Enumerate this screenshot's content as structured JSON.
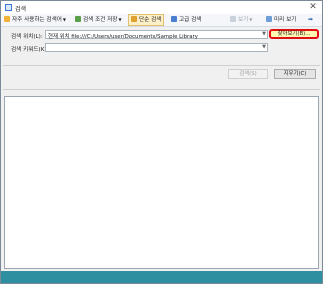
{
  "window": {
    "title": "검색"
  },
  "toolbar": {
    "frequent_searches": "자주 사용하는 검색어",
    "save_search": "검색 조건 저장",
    "simple_search": "단순 검색",
    "advanced_search": "고급 검색",
    "view": "보기",
    "preview": "미리 보기"
  },
  "form": {
    "location_label": "검색 위치(L):",
    "location_value": "현재 위치 file:///C:/Users/user/Documents/Sample Library",
    "keyword_label": "검색 키워드(K):",
    "keyword_value": "",
    "browse_button": "찾아보기(B)...",
    "search_button": "검색(S)",
    "clear_button": "지우기(C)"
  },
  "colors": {
    "status_bar": "#2e8fa0",
    "highlight_border": "#e01010"
  }
}
